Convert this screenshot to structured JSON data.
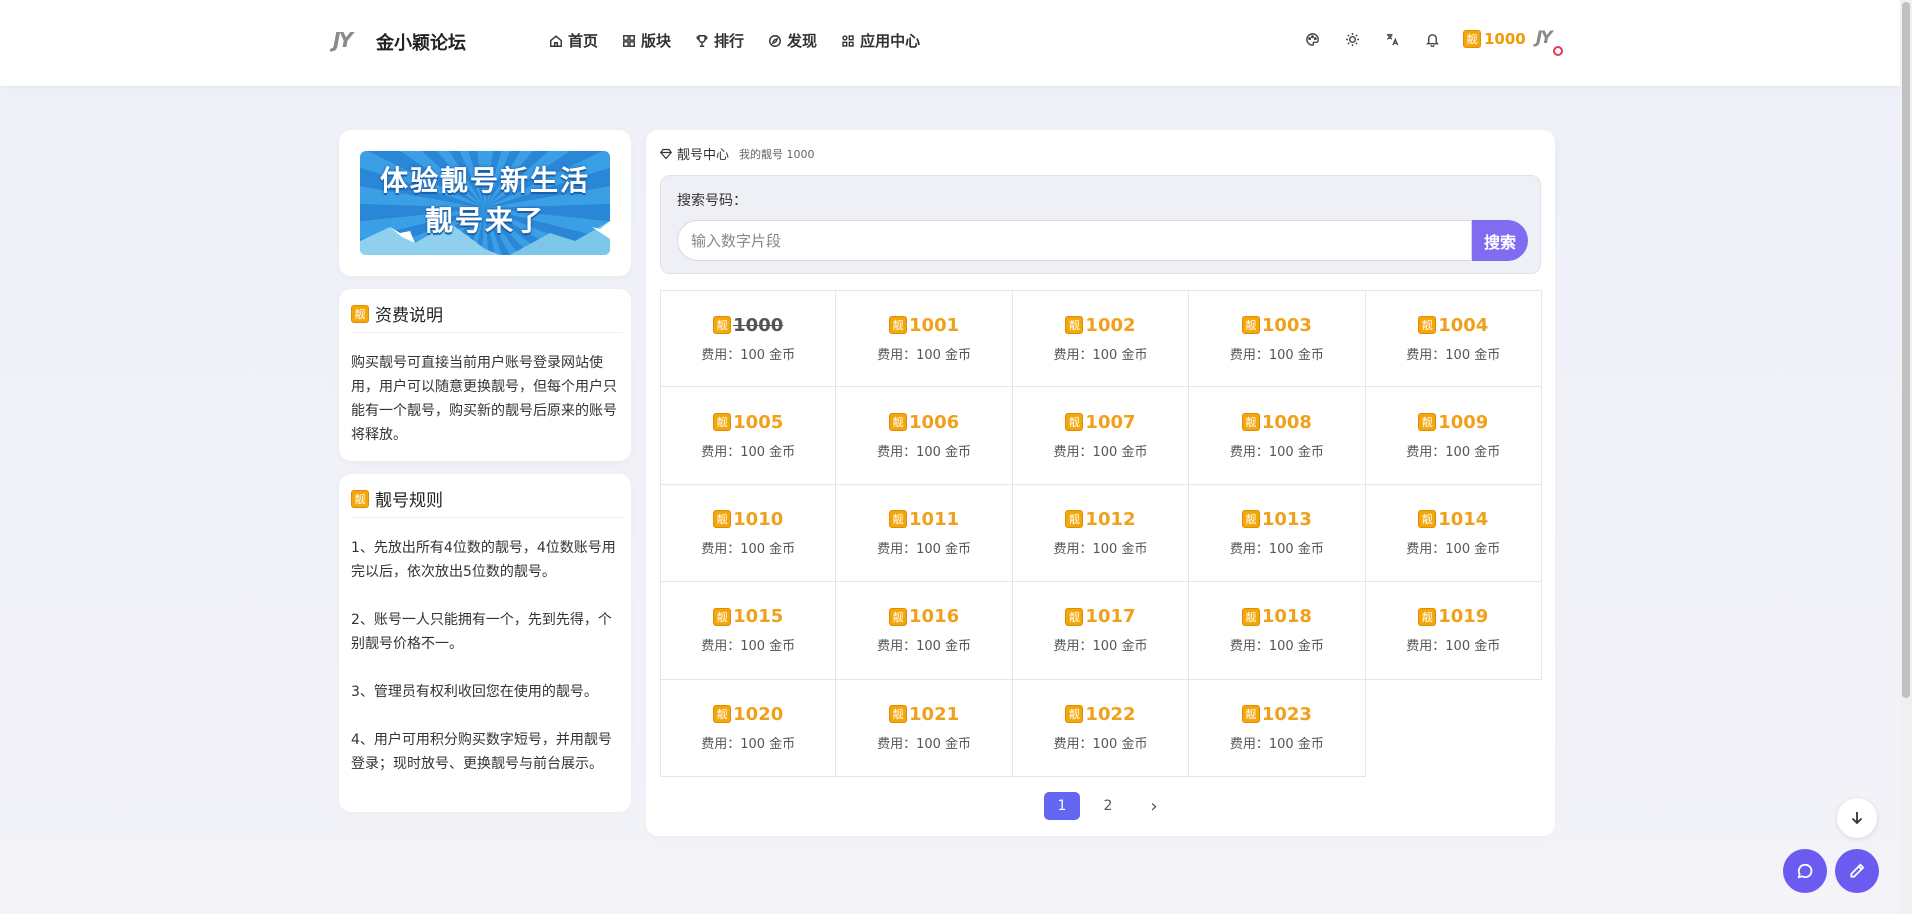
{
  "header": {
    "logo": "JY",
    "site_name": "金小颖论坛",
    "nav": [
      {
        "label": "首页",
        "icon": "home-icon"
      },
      {
        "label": "版块",
        "icon": "grid-icon"
      },
      {
        "label": "排行",
        "icon": "trophy-icon"
      },
      {
        "label": "发现",
        "icon": "compass-icon"
      },
      {
        "label": "应用中心",
        "icon": "apps-icon"
      }
    ],
    "badge_char": "靓",
    "user_number": "1000",
    "avatar_text": "JY"
  },
  "banner": {
    "line1": "体验靓号新生活",
    "line2": "靓号来了"
  },
  "fee_info": {
    "badge": "靓",
    "title": "资费说明",
    "body": "购买靓号可直接当前用户账号登录网站使用，用户可以随意更换靓号，但每个用户只能有一个靓号，购买新的靓号后原来的账号将释放。"
  },
  "rules": {
    "badge": "靓",
    "title": "靓号规则",
    "items": [
      "1、先放出所有4位数的靓号，4位数账号用完以后，依次放出5位数的靓号。",
      "2、账号一人只能拥有一个，先到先得，个别靓号价格不一。",
      "3、管理员有权利收回您在使用的靓号。",
      "4、用户可用积分购买数字短号，并用靓号登录；现时放号、更换靓号与前台展示。"
    ]
  },
  "main": {
    "breadcrumb": "靓号中心",
    "breadcrumb_sub": "我的靓号 1000",
    "search_label": "搜索号码：",
    "search_placeholder": "输入数字片段",
    "search_button": "搜索",
    "numbers": [
      {
        "number": "1000",
        "fee": "费用：100 金币",
        "taken": true
      },
      {
        "number": "1001",
        "fee": "费用：100 金币",
        "taken": false
      },
      {
        "number": "1002",
        "fee": "费用：100 金币",
        "taken": false
      },
      {
        "number": "1003",
        "fee": "费用：100 金币",
        "taken": false
      },
      {
        "number": "1004",
        "fee": "费用：100 金币",
        "taken": false
      },
      {
        "number": "1005",
        "fee": "费用：100 金币",
        "taken": false
      },
      {
        "number": "1006",
        "fee": "费用：100 金币",
        "taken": false
      },
      {
        "number": "1007",
        "fee": "费用：100 金币",
        "taken": false
      },
      {
        "number": "1008",
        "fee": "费用：100 金币",
        "taken": false
      },
      {
        "number": "1009",
        "fee": "费用：100 金币",
        "taken": false
      },
      {
        "number": "1010",
        "fee": "费用：100 金币",
        "taken": false
      },
      {
        "number": "1011",
        "fee": "费用：100 金币",
        "taken": false
      },
      {
        "number": "1012",
        "fee": "费用：100 金币",
        "taken": false
      },
      {
        "number": "1013",
        "fee": "费用：100 金币",
        "taken": false
      },
      {
        "number": "1014",
        "fee": "费用：100 金币",
        "taken": false
      },
      {
        "number": "1015",
        "fee": "费用：100 金币",
        "taken": false
      },
      {
        "number": "1016",
        "fee": "费用：100 金币",
        "taken": false
      },
      {
        "number": "1017",
        "fee": "费用：100 金币",
        "taken": false
      },
      {
        "number": "1018",
        "fee": "费用：100 金币",
        "taken": false
      },
      {
        "number": "1019",
        "fee": "费用：100 金币",
        "taken": false
      },
      {
        "number": "1020",
        "fee": "费用：100 金币",
        "taken": false
      },
      {
        "number": "1021",
        "fee": "费用：100 金币",
        "taken": false
      },
      {
        "number": "1022",
        "fee": "费用：100 金币",
        "taken": false
      },
      {
        "number": "1023",
        "fee": "费用：100 金币",
        "taken": false
      }
    ],
    "pagination": {
      "pages": [
        "1",
        "2"
      ],
      "current": "1",
      "next": "›"
    }
  },
  "colors": {
    "accent": "#6366f1",
    "gold": "#f0a01a",
    "search_button": "#7f6cf0"
  }
}
